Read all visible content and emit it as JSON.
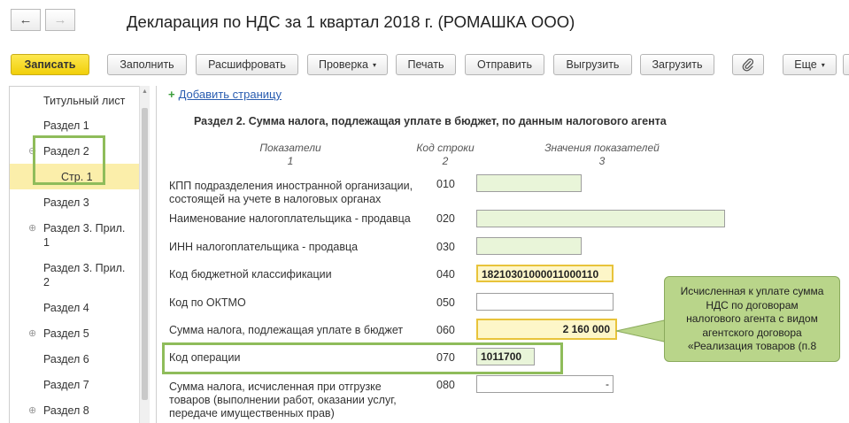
{
  "window": {
    "title": "Декларация по НДС за 1 квартал 2018 г. (РОМАШКА ООО)",
    "back_icon": "←",
    "forward_icon": "→"
  },
  "toolbar": {
    "save": "Записать",
    "fill": "Заполнить",
    "decode": "Расшифровать",
    "check": "Проверка",
    "print": "Печать",
    "send": "Отправить",
    "export": "Выгрузить",
    "import": "Загрузить",
    "attach_icon": "paperclip-icon",
    "more": "Еще",
    "caret": "▾"
  },
  "tree": {
    "items": [
      {
        "label": "Титульный лист",
        "expander": ""
      },
      {
        "label": "Раздел 1",
        "expander": ""
      },
      {
        "label": "Раздел 2",
        "expander": "⊖"
      },
      {
        "label": "Стр. 1",
        "expander": "",
        "selected": true
      },
      {
        "label": "Раздел 3",
        "expander": ""
      },
      {
        "label": "Раздел 3. Прил. 1",
        "line1": "Раздел 3. Прил.",
        "line2": "1",
        "expander": "⊕"
      },
      {
        "label": "Раздел 3. Прил. 2",
        "line1": "Раздел 3. Прил.",
        "line2": "2",
        "expander": ""
      },
      {
        "label": "Раздел 4",
        "expander": ""
      },
      {
        "label": "Раздел 5",
        "expander": "⊕"
      },
      {
        "label": "Раздел 6",
        "expander": ""
      },
      {
        "label": "Раздел 7",
        "expander": ""
      },
      {
        "label": "Раздел 8",
        "expander": "⊕"
      }
    ]
  },
  "form": {
    "add_page_icon": "+",
    "add_page": "Добавить страницу",
    "section_title": "Раздел 2. Сумма налога, подлежащая уплате в бюджет, по данным налогового агента",
    "headers": {
      "col1": "Показатели",
      "col1_num": "1",
      "col2": "Код строки",
      "col2_num": "2",
      "col3": "Значения показателей",
      "col3_num": "3"
    },
    "rows": [
      {
        "label_l1": "КПП подразделения иностранной организации,",
        "label_l2": "состоящей на учете в налоговых органах",
        "code": "010",
        "value": ""
      },
      {
        "label_l1": "Наименование налогоплательщика - продавца",
        "code": "020",
        "value": ""
      },
      {
        "label_l1": "ИНН налогоплательщика - продавца",
        "code": "030",
        "value": ""
      },
      {
        "label_l1": "Код бюджетной классификации",
        "code": "040",
        "value": "18210301000011000110"
      },
      {
        "label_l1": "Код по ОКТМО",
        "code": "050",
        "value": ""
      },
      {
        "label_l1": "Сумма налога, подлежащая уплате в бюджет",
        "code": "060",
        "value": "2 160 000"
      },
      {
        "label_l1": "Код операции",
        "code": "070",
        "value": "1011700"
      },
      {
        "label_l1": "Сумма налога, исчисленная при отгрузке",
        "label_l2": "товаров (выполнении работ, оказании услуг,",
        "label_l3": "передаче имущественных прав)",
        "code": "080",
        "value": "-"
      }
    ]
  },
  "callout": {
    "text_l1": "Исчисленная к уплате сумма",
    "text_l2": "НДС по договорам",
    "text_l3": "налогового агента с видом",
    "text_l4": "агентского договора",
    "text_l5": "«Реализация товаров (п.8"
  },
  "colors": {
    "highlight_green": "#8fbc5a",
    "accent_yellow": "#f5d327",
    "selected_row": "#fbeeaa",
    "field_green": "#e9f5d9",
    "callout": "#b9d58a"
  }
}
